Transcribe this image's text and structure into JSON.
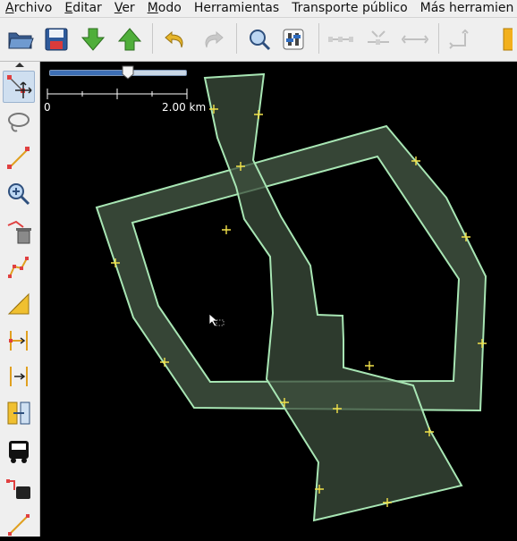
{
  "menu": [
    "Archivo",
    "Editar",
    "Ver",
    "Modo",
    "Herramientas",
    "Transporte público",
    "Más herramien"
  ],
  "menu_mnemonic": [
    "A",
    "E",
    "V",
    "M",
    "",
    "",
    ""
  ],
  "toolbar": {
    "buttons": [
      "open-icon",
      "save-icon",
      "download-icon",
      "upload-icon",
      "undo-icon",
      "redo-icon",
      "zoom-icon",
      "preferences-icon",
      "align-horizontal-icon",
      "align-merge-icon",
      "align-split-icon",
      "orthogonalize-icon"
    ],
    "disabled": [
      "redo-icon",
      "align-horizontal-icon",
      "align-merge-icon",
      "align-split-icon",
      "orthogonalize-icon"
    ]
  },
  "sidebar": {
    "tools": [
      "select-tool",
      "lasso-tool",
      "draw-tool",
      "zoom-tool",
      "delete-tool",
      "improve-way-tool",
      "parallel-tool",
      "split-tool",
      "combine-tool",
      "dimension-tool",
      "bus-tool",
      "public-transport-tool",
      "route-tool"
    ],
    "active": "select-tool"
  },
  "map": {
    "zoom_slider_level": 0.58,
    "scale": {
      "start": "0",
      "end": "2.00 km"
    },
    "colors": {
      "background": "#000000",
      "outline": "#a8e6b4",
      "fill": "#3c4d3c",
      "node": "#f2e24a"
    }
  }
}
